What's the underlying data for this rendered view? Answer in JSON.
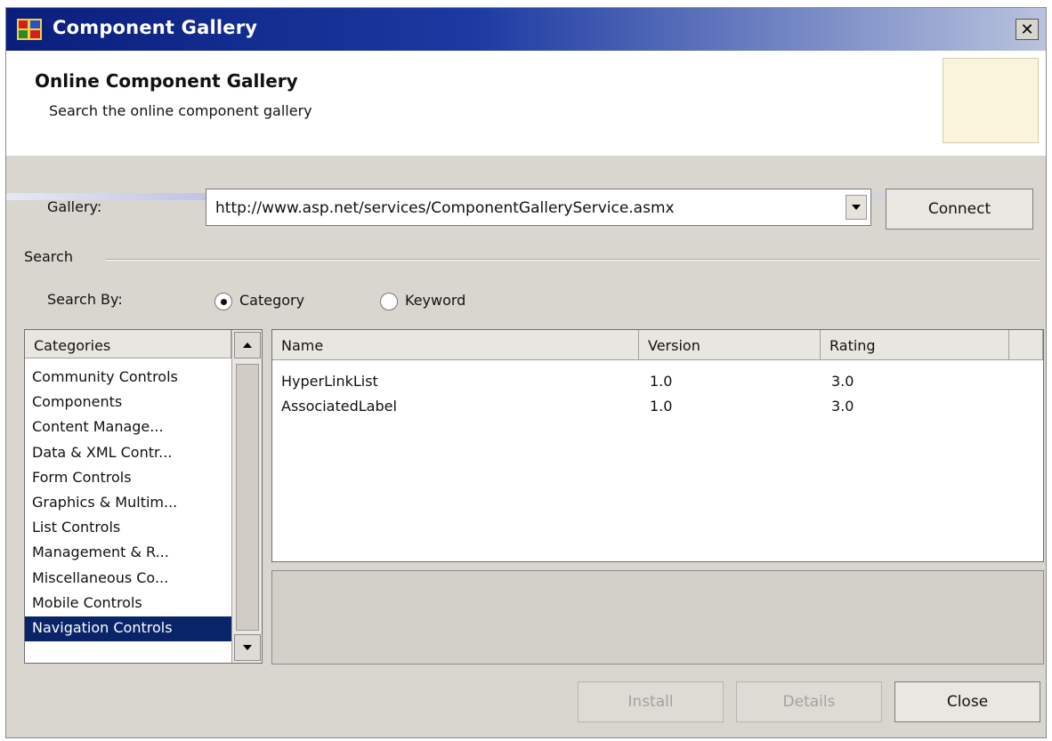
{
  "window": {
    "title": "Component Gallery",
    "close_glyph": "✕"
  },
  "header": {
    "title": "Online Component Gallery",
    "subtitle": "Search the online component gallery"
  },
  "gallery": {
    "label": "Gallery:",
    "url": "http://www.asp.net/services/ComponentGalleryService.asmx",
    "connect_label": "Connect"
  },
  "search": {
    "group_label": "Search",
    "by_label": "Search By:",
    "options": [
      {
        "label": "Category",
        "selected": true
      },
      {
        "label": "Keyword",
        "selected": false
      }
    ]
  },
  "categories": {
    "header": "Categories",
    "items": [
      "Community Controls",
      "Components",
      "Content Manage...",
      "Data & XML Contr...",
      "Form Controls",
      "Graphics & Multim...",
      "List Controls",
      "Management & R...",
      "Miscellaneous Co...",
      "Mobile Controls",
      "Navigation Controls"
    ],
    "selected_index": 10
  },
  "results": {
    "columns": [
      "Name",
      "Version",
      "Rating"
    ],
    "rows": [
      [
        "HyperLinkList",
        "1.0",
        "3.0"
      ],
      [
        "AssociatedLabel",
        "1.0",
        "3.0"
      ]
    ]
  },
  "footer": {
    "install_label": "Install",
    "details_label": "Details",
    "close_label": "Close"
  },
  "colors": {
    "title_bar": "#0a1e7c",
    "selection": "#0a246a",
    "dialog_bg": "#d9d6cf"
  },
  "icons": {
    "app": "component-gallery-icon",
    "dropdown": "chevron-down-icon",
    "scroll_up": "arrow-up-icon",
    "scroll_down": "arrow-down-icon"
  }
}
